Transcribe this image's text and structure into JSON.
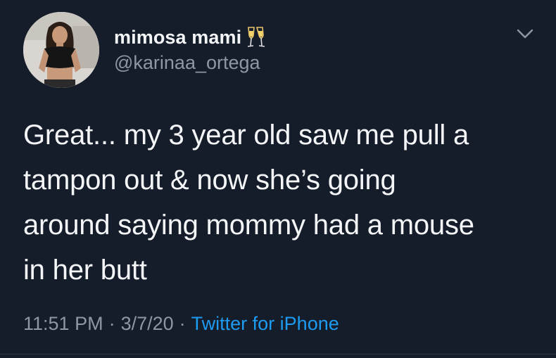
{
  "tweet": {
    "display_name": "mimosa mami",
    "emoji": "champagne-glasses-icon",
    "handle": "@karinaa_ortega",
    "text": "Great... my 3 year old saw me pull a\ntampon out & now she’s going\naround saying mommy had a mouse\nin her butt",
    "time": "11:51 PM",
    "date": "3/7/20",
    "separator": "·",
    "source": "Twitter for iPhone"
  },
  "icons": {
    "menu": "chevron-down-icon",
    "avatar": "avatar"
  },
  "colors": {
    "background": "#151c2a",
    "text_primary": "#f3f5f7",
    "text_secondary": "#8c98a6",
    "link": "#1d9bf0"
  }
}
